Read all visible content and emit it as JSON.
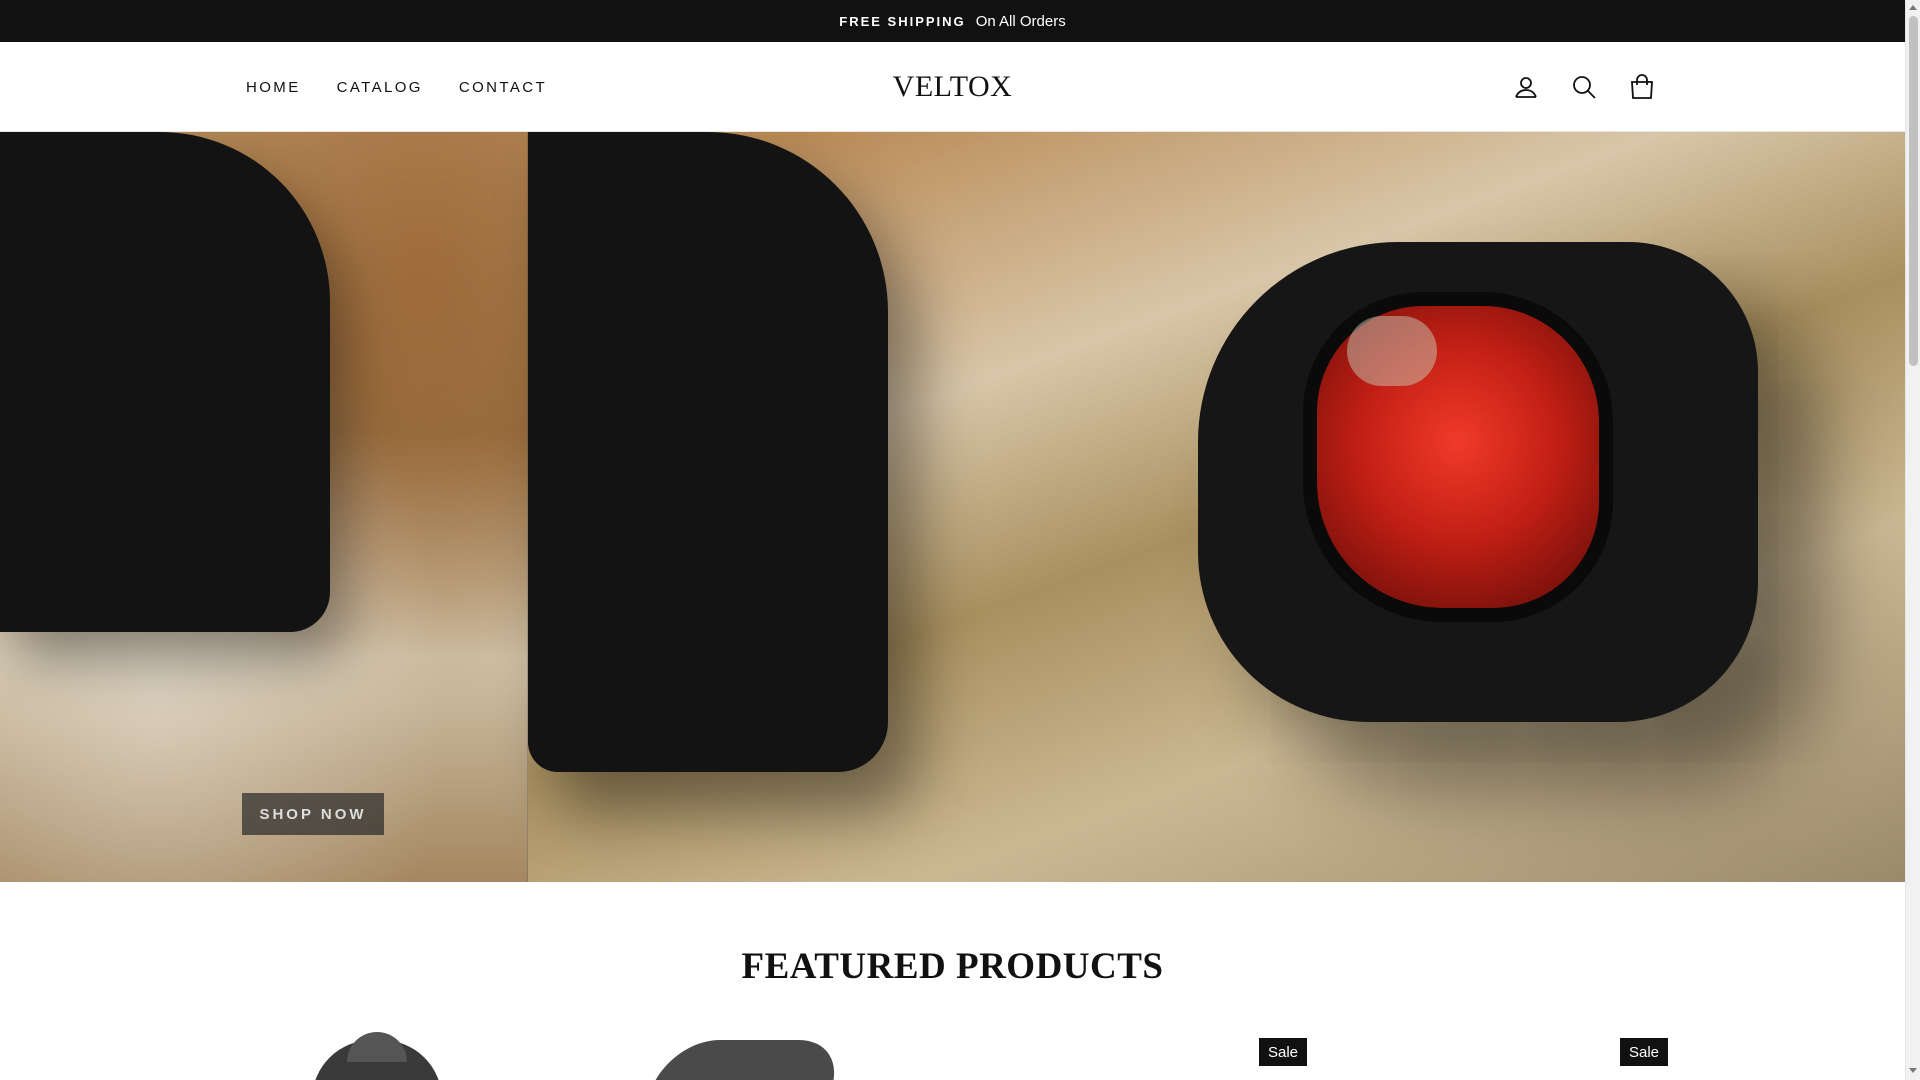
{
  "announcement": {
    "strong": "FREE SHIPPING",
    "rest": "On All Orders"
  },
  "header": {
    "nav": [
      {
        "label": "HOME"
      },
      {
        "label": "CATALOG"
      },
      {
        "label": "CONTACT"
      }
    ],
    "logo": "VELTOX",
    "icons": [
      "user-icon",
      "search-icon",
      "cart-icon"
    ]
  },
  "hero": {
    "button_label": "SHOP NOW"
  },
  "featured": {
    "title": "FEATURED PRODUCTS",
    "badges": [
      "Sale",
      "Sale"
    ]
  }
}
